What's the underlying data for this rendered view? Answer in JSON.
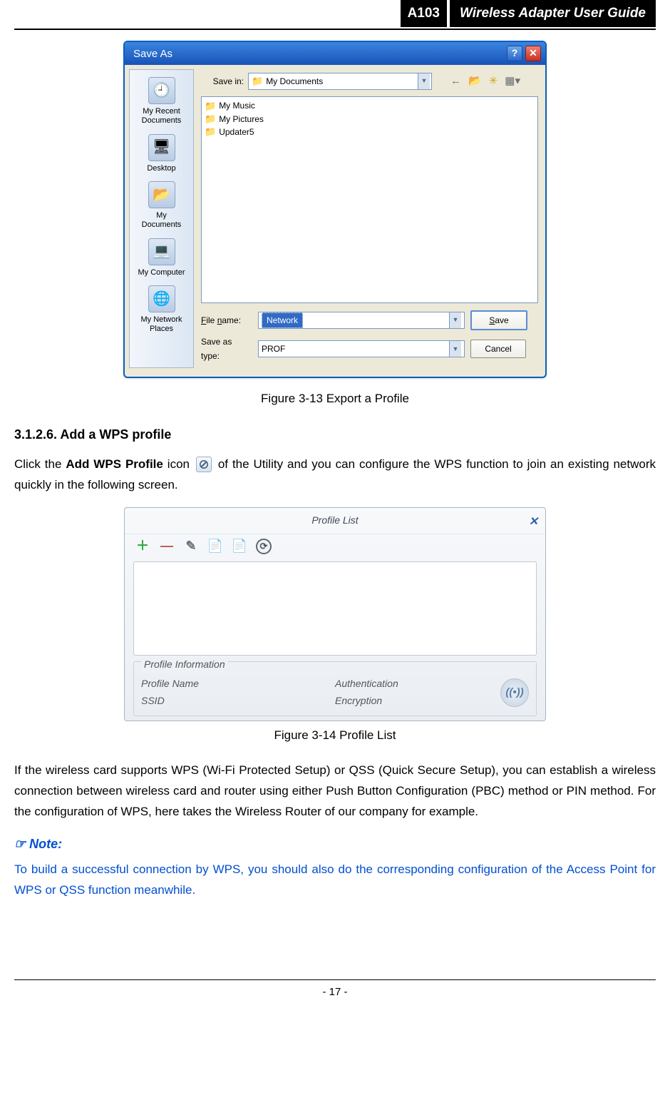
{
  "header": {
    "model": "A103",
    "title": "Wireless Adapter User Guide"
  },
  "save_as": {
    "title": "Save As",
    "save_in_label": "Save in:",
    "save_in_value": "My Documents",
    "nav_icons": [
      "←",
      "folder-up",
      "new-folder",
      "view"
    ],
    "places": [
      {
        "label": "My Recent Documents",
        "glyph": "🕘"
      },
      {
        "label": "Desktop",
        "glyph": "🖥"
      },
      {
        "label": "My Documents",
        "glyph": "📂"
      },
      {
        "label": "My Computer",
        "glyph": "💻"
      },
      {
        "label": "My Network Places",
        "glyph": "🌐"
      }
    ],
    "file_items": [
      "My Music",
      "My Pictures",
      "Updater5"
    ],
    "file_name_label": "File name:",
    "file_name_value": "Network",
    "save_type_label": "Save as type:",
    "save_type_value": "PROF",
    "save_button": "Save",
    "cancel_button": "Cancel"
  },
  "fig1_caption": "Figure 3-13 Export a Profile",
  "section_heading": "3.1.2.6.   Add a WPS profile",
  "para1_pre": "Click the ",
  "para1_bold": "Add WPS Profile",
  "para1_mid": " icon ",
  "para1_post": " of the Utility and you can configure the WPS function to join an existing network quickly in the following screen.",
  "profile_list": {
    "title": "Profile List",
    "info_legend": "Profile Information",
    "profile_name_label": "Profile Name",
    "ssid_label": "SSID",
    "auth_label": "Authentication",
    "enc_label": "Encryption"
  },
  "fig2_caption": "Figure 3-14 Profile List",
  "para2": "If the wireless card supports WPS (Wi-Fi Protected Setup) or QSS (Quick Secure Setup), you can establish a wireless connection between wireless card and router using either Push Button Configuration (PBC) method or PIN method. For the configuration of WPS, here takes the Wireless Router of our company for example.",
  "note_head": "Note:",
  "note_body": "To build a successful connection by WPS, you should also do the corresponding configuration of the Access Point for WPS or QSS function meanwhile.",
  "page_number": "- 17 -"
}
